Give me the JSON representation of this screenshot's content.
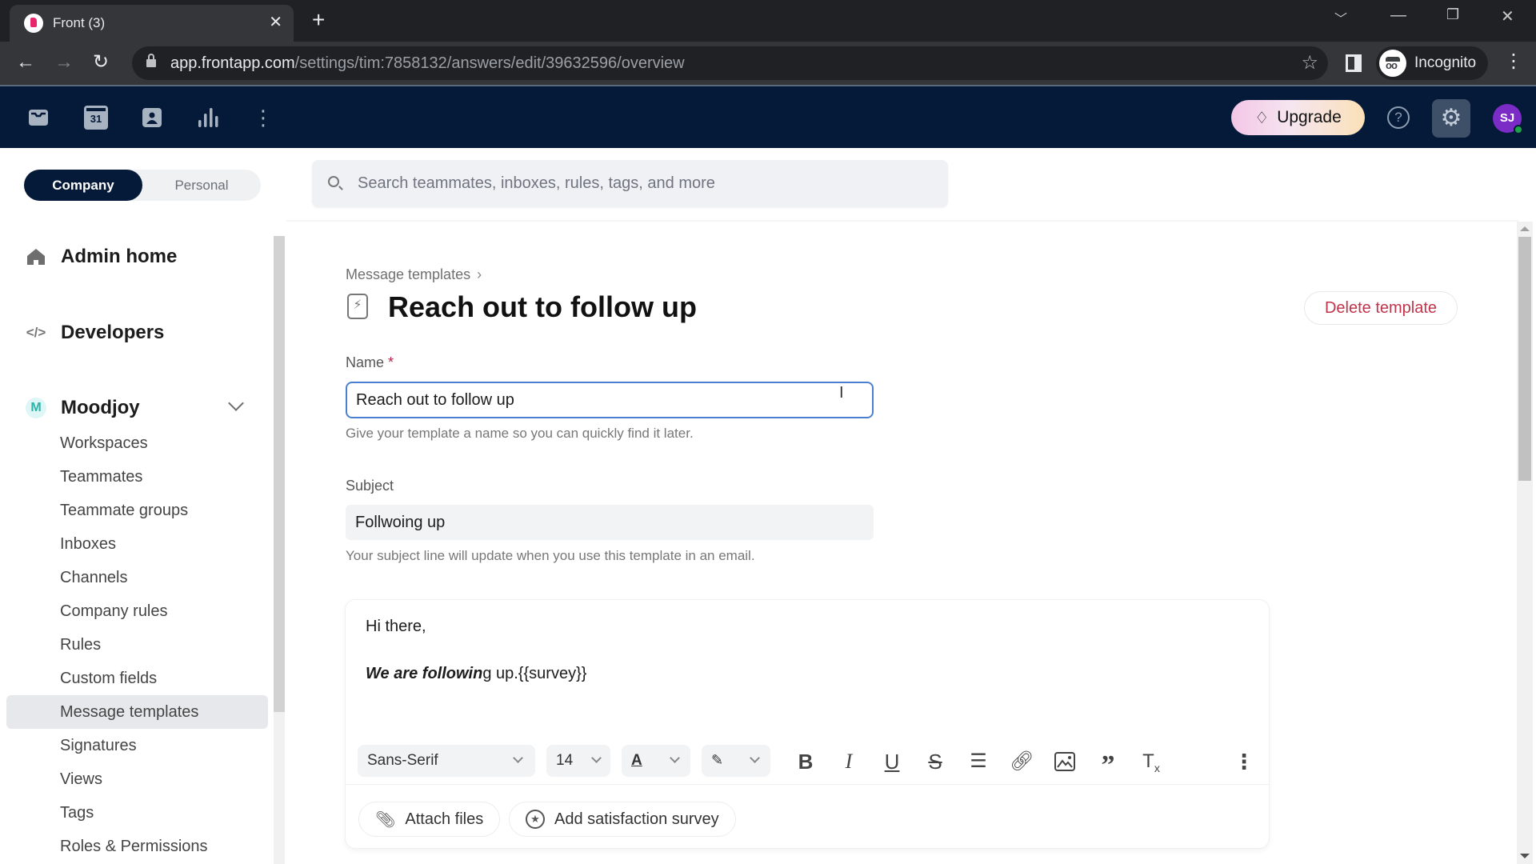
{
  "browser": {
    "tab_title": "Front (3)",
    "url_host": "app.frontapp.com",
    "url_path": "/settings/tim:7858132/answers/edit/39632596/overview",
    "profile_label": "Incognito"
  },
  "appbar": {
    "icons": [
      "inbox-icon",
      "calendar-icon",
      "contacts-icon",
      "analytics-icon",
      "more-icon"
    ],
    "calendar_day": "31",
    "upgrade_label": "Upgrade",
    "help_glyph": "?",
    "avatar_initials": "SJ",
    "colors": {
      "header_bg": "#051a38",
      "avatar_bg": "#7b2bc6",
      "online": "#1ea446"
    }
  },
  "sidebar": {
    "scope_options": [
      "Company",
      "Personal"
    ],
    "scope_selected": "Company",
    "admin_home": "Admin home",
    "developers": "Developers",
    "workspace_badge": "M",
    "workspace_name": "Moodjoy",
    "items": [
      {
        "label": "Workspaces"
      },
      {
        "label": "Teammates"
      },
      {
        "label": "Teammate groups"
      },
      {
        "label": "Inboxes"
      },
      {
        "label": "Channels"
      },
      {
        "label": "Company rules"
      },
      {
        "label": "Rules"
      },
      {
        "label": "Custom fields"
      },
      {
        "label": "Message templates",
        "active": true
      },
      {
        "label": "Signatures"
      },
      {
        "label": "Views"
      },
      {
        "label": "Tags"
      },
      {
        "label": "Roles & Permissions"
      }
    ]
  },
  "main": {
    "search_placeholder": "Search teammates, inboxes, rules, tags, and more",
    "breadcrumb": "Message templates",
    "breadcrumb_sep": "›",
    "title": "Reach out to follow up",
    "delete_label": "Delete template",
    "name_label": "Name",
    "required_mark": "*",
    "name_value": "Reach out to follow up",
    "name_help": "Give your template a name so you can quickly find it later.",
    "subject_label": "Subject",
    "subject_value": "Follwoing up",
    "subject_help": "Your subject line will update when you use this template in an email.",
    "editor": {
      "line1": "Hi there,",
      "line2_bold_italic": "We are followin",
      "line2_rest": "g up.{{survey}}",
      "font_family": "Sans-Serif",
      "font_size": "14",
      "text_color_glyph": "A",
      "attach_label": "Attach files",
      "survey_label": "Add satisfaction survey"
    },
    "colors": {
      "danger": "#c0344b",
      "focus": "#4a7fd1"
    }
  }
}
